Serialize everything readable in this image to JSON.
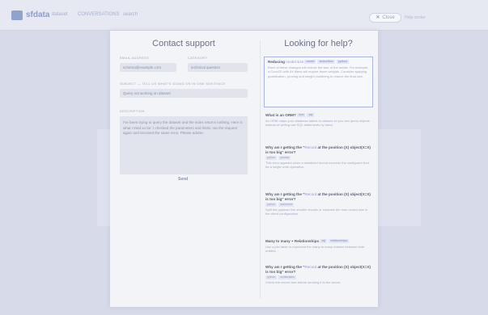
{
  "app": {
    "brand": "sfdata",
    "nav": [
      "dataset",
      "CONVERSATIONS",
      "search"
    ],
    "close_label": "Close",
    "top_right": "Help center"
  },
  "contact": {
    "title": "Contact support",
    "fields": {
      "username_label": "EMAIL ADDRESS",
      "username_value": "schema@example.com",
      "category_label": "CATEGORY",
      "category_value": "technical question",
      "subject_label": "SUBJECT — TELL US WHAT'S GOING ON IN ONE SENTENCE",
      "subject_value": "Query not working on dataset",
      "message_label": "DESCRIPTION",
      "message_value": "I've been trying to query the dataset and the index returns nothing. Here is what I tried so far: I checked the parameters and limits, ran the request again and received the same error. Please advise."
    },
    "send_label": "Send"
  },
  "help": {
    "title": "Looking for help?",
    "featured": {
      "title": "Reducing",
      "title_hl": "model size",
      "tags": [
        "model",
        "tensorflow",
        "python"
      ],
      "snippet": "Each of these changes will reduce the size of the model. For example, a Conv2D with 64 filters will require fewer weights. Consider applying quantization, pruning and weight clustering to reduce the final size."
    },
    "results": [
      {
        "title": "What is an ORM?",
        "tags": [
          "orm",
          "sql"
        ],
        "snippet": "An ORM maps your database tables to classes so you can query objects instead of writing raw SQL statements by hand."
      },
      {
        "title_pre": "Why am I getting the \"",
        "title_hl": "Record",
        "title_post": " at the position (X) object(X=X) is too big\" error?",
        "tags": [
          "python",
          "pandas"
        ],
        "snippet": "This error appears when a serialized record exceeds the configured limit for a single write operation."
      },
      {
        "title_pre": "Why am I getting the \"",
        "title_hl": "Record",
        "title_post": " at the position (X) object(X=X) is too big\" error?",
        "tags": [
          "python",
          "dataframe"
        ],
        "snippet": "Split the payload into smaller chunks or increase the max record size in the client configuration."
      },
      {
        "title_pre": "Many to many",
        "title_hl": "",
        "title_post": " + Relationships",
        "tags": [
          "sql",
          "relationships"
        ],
        "snippet": "Use a join table to represent the many to many relation between both entities."
      },
      {
        "title_pre": "Why am I getting the \"",
        "title_hl": "Record",
        "title_post": " at the position (X) object(X=X) is too big\" error?",
        "tags": [
          "python",
          "serialization"
        ],
        "snippet": "Check the record size before sending it to the server."
      }
    ]
  }
}
